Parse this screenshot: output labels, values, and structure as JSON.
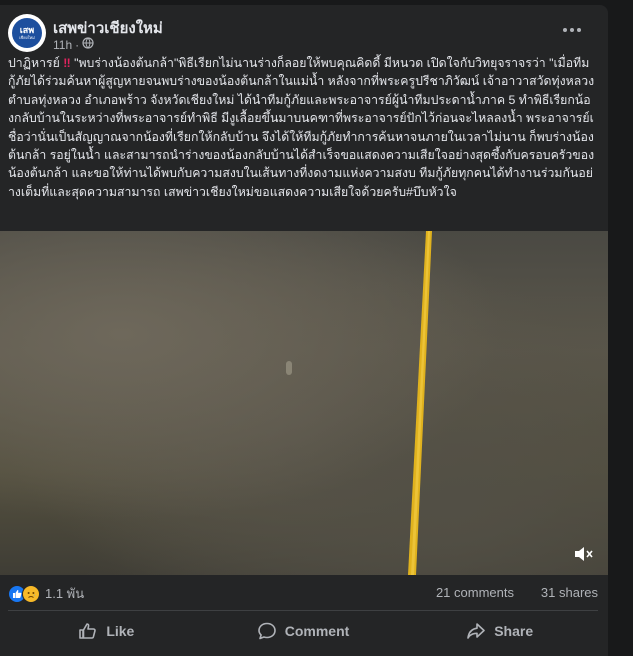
{
  "post": {
    "page_name": "เสพข่าวเชียงใหม่",
    "avatar_text": "เสพ",
    "avatar_subtext": "เชียงใหม่",
    "time": "11h",
    "dot_separator": "·",
    "body_intro": "ปาฏิหารย์",
    "body_main": " \"พบร่างน้องต้นกล้า\"พิธีเรียกไม่นานร่างก็ลอยให้พบคุณคิดดี้ มีหนวด เปิดใจกับวิทยุจราจรว่า \"เมื่อทีมกู้ภัยได้ร่วมค้นหาผู้สูญหายจนพบร่างของน้องต้นกล้าในแม่น้ำ หลังจากที่พระครูปรีชาภิวัฒน์ เจ้าอาวาสวัดทุ่งหลวง ตำบลทุ่งหลวง อำเภอพร้าว จังหวัดเชียงใหม่ ได้นำทีมกู้ภัยและพระอาจารย์ผู้นำทีมประดาน้ำภาค 5 ทำพิธีเรียกน้องกลับบ้านในระหว่างที่พระอาจารย์ทำพิธี มีงูเลื้อยขึ้นมาบนคฑาที่พระอาจารย์ปักไว้ก่อนจะไหลลงน้ำ พระอาจารย์เชื่อว่านั่นเป็นสัญญาณจากน้องที่เรียกให้กลับบ้าน จึงได้ให้ทีมกู้ภัยทำการค้นหาจนภายในเวลาไม่นาน ก็พบร่างน้องต้นกล้า รอยู่ในน้ำ และสามารถนำร่างของน้องกลับบ้านได้สำเร็จขอแสดงความเสียใจอย่างสุดซึ้งกับครอบครัวของน้องต้นกล้า และขอให้ท่านได้พบกับความสงบในเส้นทางที่งดงามแห่งความสงบ ทีมกู้ภัยทุกคนได้ทำงานร่วมกันอย่างเต็มที่และสุดความสามารถ เสพข่าวเชียงใหม่ขอแสดงความเสียใจด้วยครับ",
    "hashtag": "#บึบหัวใจ",
    "reaction_count": "1.1 พัน",
    "comments": "21 comments",
    "shares": "31 shares",
    "actions": {
      "like": "Like",
      "comment": "Comment",
      "share": "Share"
    }
  },
  "colors": {
    "card_bg": "#242526",
    "page_bg": "#18191a",
    "text_primary": "#e4e6eb",
    "text_secondary": "#b0b3b8",
    "like_blue": "#1877f2",
    "sad_yellow": "#f7b928",
    "pole_yellow": "#e0b21e"
  },
  "icons": {
    "menu": "more-dots-icon",
    "privacy": "globe-icon",
    "mute": "speaker-muted-icon",
    "like_reaction": "thumbs-up-icon",
    "sad_reaction": "sad-face-icon",
    "like_action": "thumbs-up-outline-icon",
    "comment_action": "speech-bubble-icon",
    "share_action": "share-arrow-icon"
  }
}
